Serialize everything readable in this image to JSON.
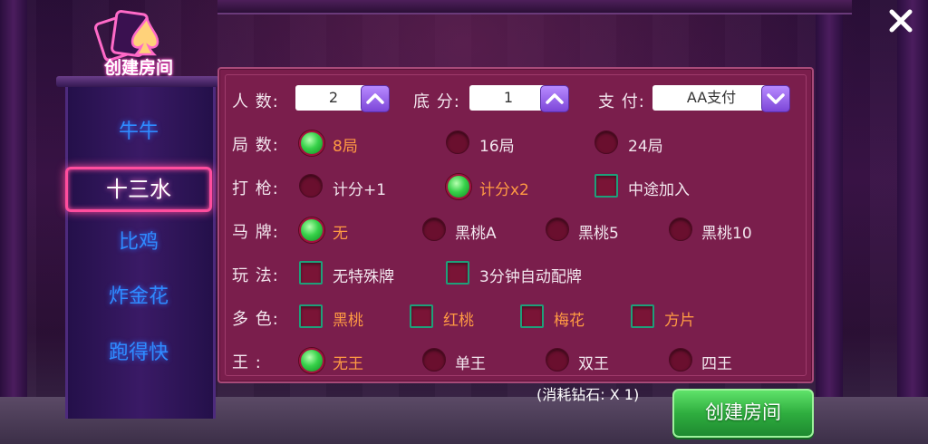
{
  "logo": {
    "title": "创建房间"
  },
  "nav": {
    "items": [
      {
        "label": "牛牛"
      },
      {
        "label": "十三水"
      },
      {
        "label": "比鸡"
      },
      {
        "label": "炸金花"
      },
      {
        "label": "跑得快"
      }
    ],
    "active_index": 1
  },
  "form": {
    "players": {
      "label": "人  数:",
      "value": "2"
    },
    "base_score": {
      "label": "底  分:",
      "value": "1"
    },
    "payment": {
      "label": "支  付:",
      "value": "AA支付"
    },
    "rounds": {
      "label": "局  数:",
      "options": [
        "8局",
        "16局",
        "24局"
      ],
      "selected": 0
    },
    "gun": {
      "label": "打  枪:",
      "options": [
        "计分+1",
        "计分x2"
      ],
      "selected": 1,
      "checkbox_label": "中途加入"
    },
    "horse_card": {
      "label": "马  牌:",
      "options": [
        "无",
        "黑桃A",
        "黑桃5",
        "黑桃10"
      ],
      "selected": 0
    },
    "play_mode": {
      "label": "玩  法:",
      "options": [
        "无特殊牌",
        "3分钟自动配牌"
      ]
    },
    "multi_color": {
      "label": "多  色:",
      "options": [
        "黑桃",
        "红桃",
        "梅花",
        "方片"
      ]
    },
    "king": {
      "label": "王    :",
      "options": [
        "无王",
        "单王",
        "双王",
        "四王"
      ],
      "selected": 0
    }
  },
  "footer": {
    "cost_text": "(消耗钻石: X 1)",
    "create_button": "创建房间"
  },
  "colors": {
    "panel_bg": "#7a1e4c",
    "selected_text": "#ff9a43",
    "nav_text": "#2f8bff",
    "active_border": "#ff4d9e",
    "create_button": "#2fae3f"
  },
  "icons": {
    "close": "close-icon",
    "up_arrow": "chevron-up-icon",
    "down_arrow": "chevron-down-icon",
    "logo": "poker-cards-logo-icon"
  }
}
